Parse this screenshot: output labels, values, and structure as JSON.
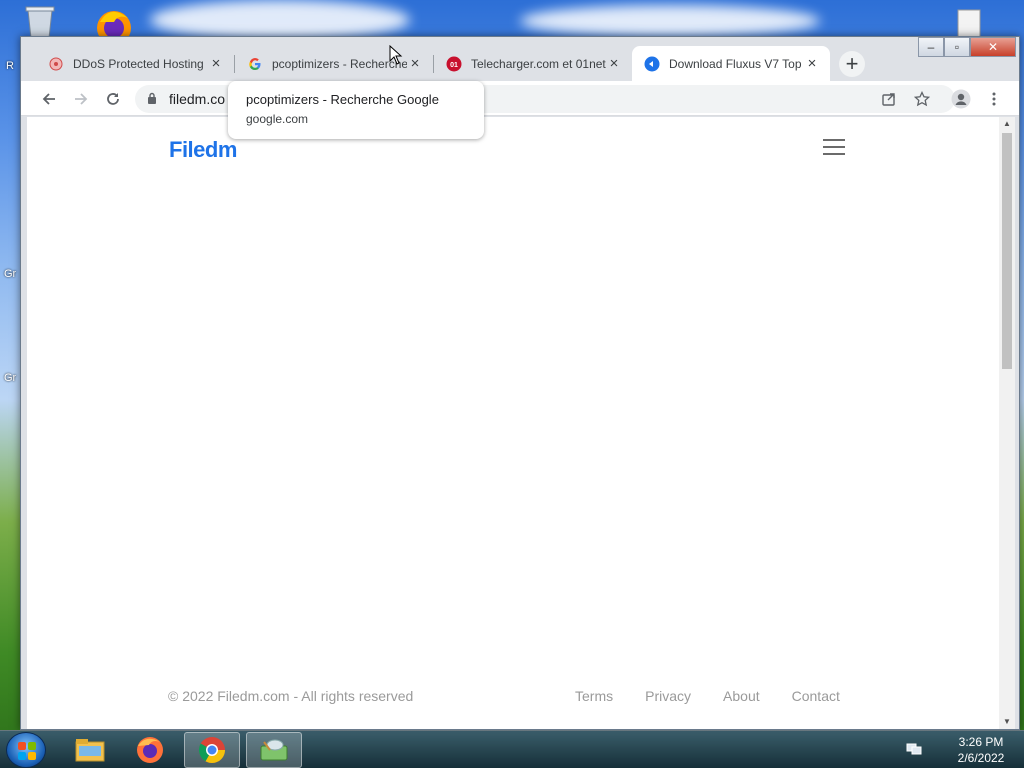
{
  "desktop": {
    "label_left_1": "R",
    "label_left_2": "Gr",
    "label_left_3": "Gr"
  },
  "browser": {
    "tabs": [
      {
        "title": "DDoS Protected Hosting",
        "favicon": "ddos-favicon-icon",
        "active": false
      },
      {
        "title": "pcoptimizers - Recherche",
        "favicon": "google-favicon-icon",
        "active": false
      },
      {
        "title": "Telecharger.com et 01net",
        "favicon": "01net-favicon-icon",
        "active": false
      },
      {
        "title": "Download Fluxus V7 Top",
        "favicon": "filedm-favicon-icon",
        "active": true
      }
    ],
    "close_glyph": "×",
    "newtab_glyph": "+",
    "window_controls": {
      "minimize": "–",
      "maximize": "▫",
      "close": "✕"
    },
    "address": "filedm.co",
    "tooltip": {
      "title": "pcoptimizers - Recherche Google",
      "domain": "google.com"
    }
  },
  "page": {
    "logo": "Filedm",
    "copyright": "© 2022 Filedm.com - All rights reserved",
    "footer_links": [
      "Terms",
      "Privacy",
      "About",
      "Contact"
    ]
  },
  "taskbar": {
    "time": "3:26 PM",
    "date": "2/6/2022"
  },
  "colors": {
    "brand": "#1e73e8",
    "footer_text": "#9a9a9a"
  }
}
